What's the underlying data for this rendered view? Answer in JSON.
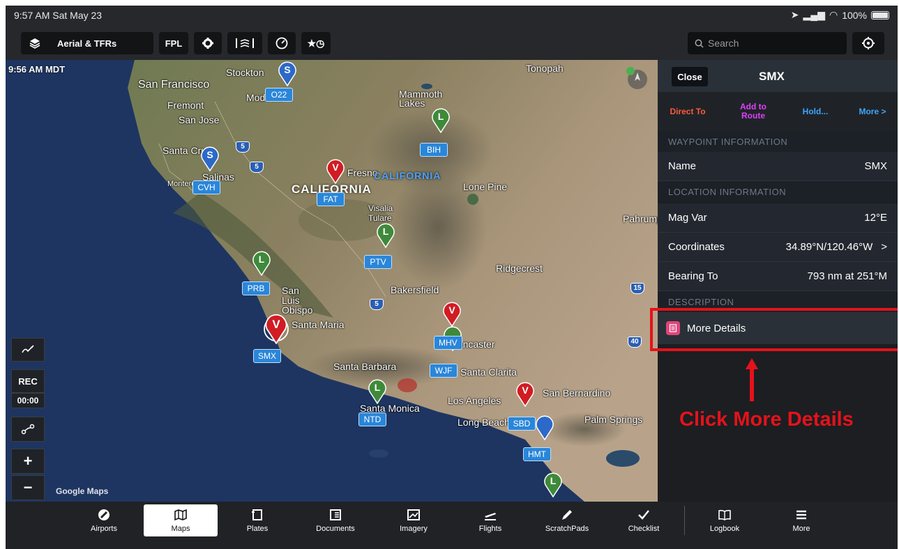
{
  "status_bar": {
    "time": "9:57 AM  Sat May 23",
    "battery": "100%"
  },
  "toolbar": {
    "layer_label": "Aerial & TFRs",
    "fpl_label": "FPL",
    "search_placeholder": "Search"
  },
  "map": {
    "timestamp": "9:56 AM MDT",
    "attribution": "Google Maps",
    "cities": [
      "Stockton",
      "San Francisco",
      "Modesto",
      "Fremont",
      "San Jose",
      "Santa Cruz",
      "Salinas",
      "Monterey",
      "Fresno",
      "Visalia",
      "Tulare",
      "Lone Pine",
      "Mammoth Lakes",
      "Tonopah",
      "Pahrump",
      "Ridgecrest",
      "Bakersfield",
      "San Luis Obispo",
      "Santa Maria",
      "Santa Barbara",
      "Lancaster",
      "Santa Clarita",
      "Santa Monica",
      "Los Angeles",
      "San Bernardino",
      "Long Beach",
      "Palm Springs"
    ],
    "state_labels": [
      "CALIFORNIA",
      "CALIFORNIA"
    ],
    "waypoints": [
      "O22",
      "BIH",
      "CVH",
      "FAT",
      "PTV",
      "PRB",
      "SMX",
      "MHV",
      "WJF",
      "NTD",
      "SBD",
      "HMT"
    ],
    "highways": [
      "5",
      "5",
      "5",
      "15",
      "40"
    ],
    "controls": {
      "rec": "REC",
      "timer": "00:00"
    }
  },
  "panel": {
    "close_label": "Close",
    "title": "SMX",
    "actions": {
      "direct_to": "Direct To",
      "add_to_route": "Add to Route",
      "hold": "Hold...",
      "more": "More >"
    },
    "sections": {
      "waypoint": "WAYPOINT INFORMATION",
      "location": "LOCATION INFORMATION",
      "description": "DESCRIPTION"
    },
    "rows": {
      "name_label": "Name",
      "name_value": "SMX",
      "magvar_label": "Mag Var",
      "magvar_value": "12°E",
      "coords_label": "Coordinates",
      "coords_value": "34.89°N/120.46°W",
      "bearing_label": "Bearing To",
      "bearing_value": "793 nm at 251°M"
    },
    "more_details": "More Details"
  },
  "annotation": {
    "text": "Click More Details",
    "color": "#e5121a"
  },
  "tabs": [
    "Airports",
    "Maps",
    "Plates",
    "Documents",
    "Imagery",
    "Flights",
    "ScratchPads",
    "Checklist",
    "Logbook",
    "More"
  ],
  "colors": {
    "accent_red": "#e5121a",
    "direct_to": "#ff5a3c",
    "add_route": "#e040fb",
    "link_blue": "#3ea6ff",
    "waypoint_blue": "#2a86d9"
  }
}
